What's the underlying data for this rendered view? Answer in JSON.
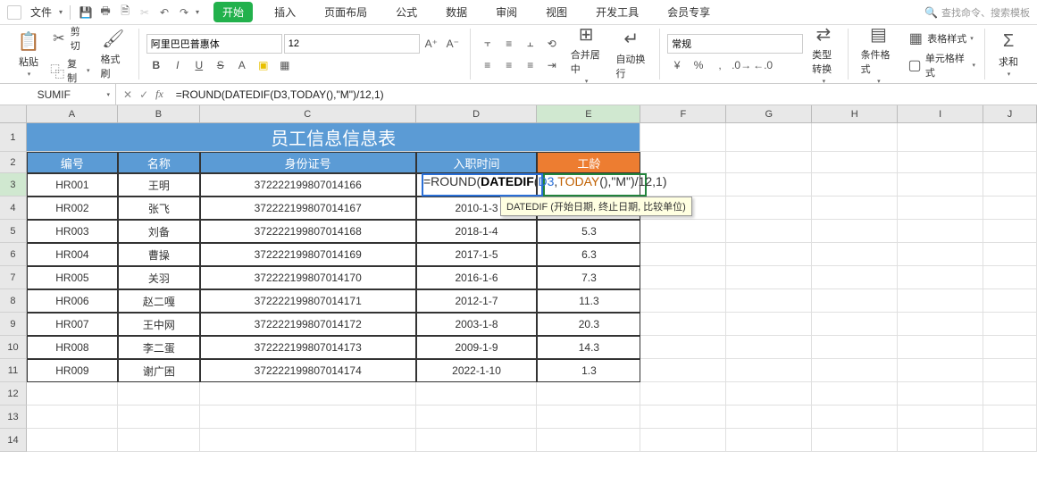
{
  "menubar": {
    "file_label": "文件",
    "icons": [
      "save-icon",
      "print-icon",
      "print-preview-icon",
      "undo-icon",
      "redo-icon"
    ]
  },
  "tabs": [
    "开始",
    "插入",
    "页面布局",
    "公式",
    "数据",
    "审阅",
    "视图",
    "开发工具",
    "会员专享"
  ],
  "active_tab_index": 0,
  "search_placeholder": "查找命令、搜索模板",
  "ribbon": {
    "paste_label": "粘贴",
    "cut_label": "剪切",
    "copy_label": "复制",
    "format_painter_label": "格式刷",
    "font_name": "阿里巴巴普惠体",
    "font_size": "12",
    "merge_label": "合并居中",
    "wrap_label": "自动换行",
    "number_format": "常规",
    "type_convert_label": "类型转换",
    "cond_format_label": "条件格式",
    "table_style_label": "表格样式",
    "cell_style_label": "单元格样式",
    "sum_label": "求和"
  },
  "name_box": "SUMIF",
  "formula_text": "=ROUND(DATEDIF(D3,TODAY(),\"M\")/12,1)",
  "formula_parts": {
    "p1": "=ROUND(",
    "p2": "DATEDIF",
    "p3": "(",
    "p4": "D3",
    "p5": ",",
    "p6": "TODAY",
    "p7": "(),\"M\")",
    "p8": "/12,1)"
  },
  "tooltip_text": "DATEDIF (开始日期, 终止日期, 比较单位)",
  "columns": [
    "A",
    "B",
    "C",
    "D",
    "E",
    "F",
    "G",
    "H",
    "I",
    "J"
  ],
  "table": {
    "title": "员工信息信息表",
    "headers": [
      "编号",
      "名称",
      "身份证号",
      "入职时间",
      "工龄"
    ],
    "rows": [
      {
        "id": "HR001",
        "name": "王明",
        "idcard": "372222199807014166",
        "date": "",
        "tenure": ""
      },
      {
        "id": "HR002",
        "name": "张飞",
        "idcard": "372222199807014167",
        "date": "2010-1-3",
        "tenure": ""
      },
      {
        "id": "HR003",
        "name": "刘备",
        "idcard": "372222199807014168",
        "date": "2018-1-4",
        "tenure": "5.3"
      },
      {
        "id": "HR004",
        "name": "曹操",
        "idcard": "372222199807014169",
        "date": "2017-1-5",
        "tenure": "6.3"
      },
      {
        "id": "HR005",
        "name": "关羽",
        "idcard": "372222199807014170",
        "date": "2016-1-6",
        "tenure": "7.3"
      },
      {
        "id": "HR006",
        "name": "赵二嘎",
        "idcard": "372222199807014171",
        "date": "2012-1-7",
        "tenure": "11.3"
      },
      {
        "id": "HR007",
        "name": "王中网",
        "idcard": "372222199807014172",
        "date": "2003-1-8",
        "tenure": "20.3"
      },
      {
        "id": "HR008",
        "name": "李二蛋",
        "idcard": "372222199807014173",
        "date": "2009-1-9",
        "tenure": "14.3"
      },
      {
        "id": "HR009",
        "name": "谢广困",
        "idcard": "372222199807014174",
        "date": "2022-1-10",
        "tenure": "1.3"
      }
    ]
  },
  "empty_rows": [
    12,
    13,
    14
  ]
}
